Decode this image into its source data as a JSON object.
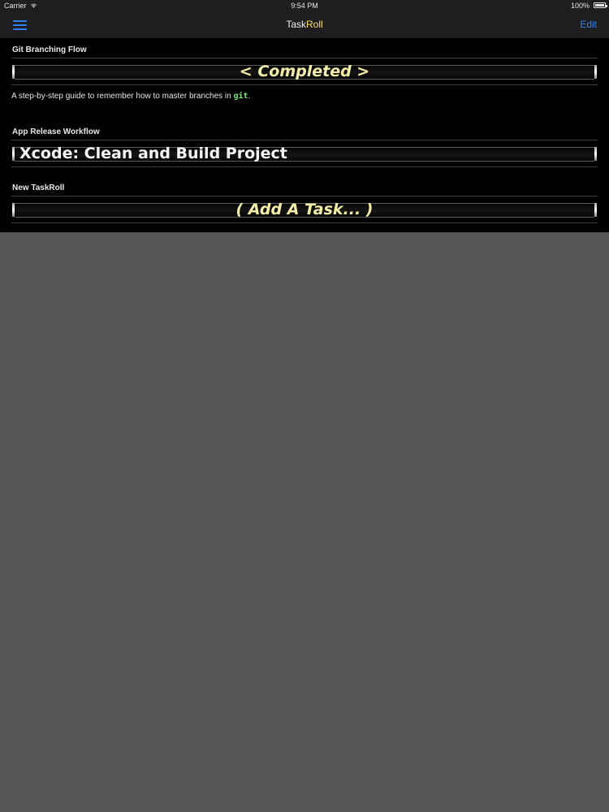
{
  "status_bar": {
    "carrier": "Carrier",
    "time": "9:54 PM",
    "battery": "100%",
    "battery_level": 1.0
  },
  "nav": {
    "title_part1": "Task",
    "title_part2": "Roll",
    "edit_label": "Edit",
    "accent_color": "#2f82f0",
    "title_accent_color": "#f3e06a"
  },
  "taskrolls": [
    {
      "title": "Git Branching Flow",
      "current_task": "< Completed >",
      "description_prefix": "A step-by-step guide to remember how to master branches in ",
      "description_code": "git",
      "description_suffix": "."
    },
    {
      "title": "App Release Workflow",
      "current_task": "Xcode: Clean and Build Project"
    },
    {
      "title": "New TaskRoll",
      "current_task": "( Add A Task... )"
    }
  ],
  "icons": [
    "wifi-icon",
    "battery-icon",
    "menu-icon"
  ]
}
